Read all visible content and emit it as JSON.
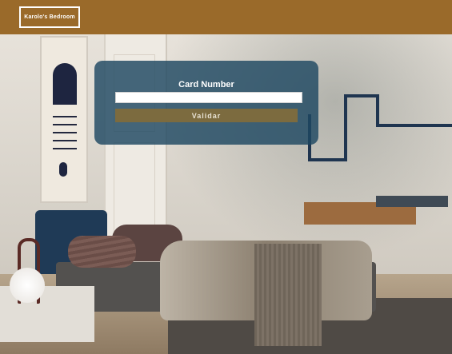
{
  "header": {
    "logo_text": "Karolo's Bedroom"
  },
  "form": {
    "title": "Card Number",
    "input_value": "",
    "submit_label": "Validar"
  },
  "colors": {
    "header_bg": "#9a6a2a",
    "overlay_bg": "#1f4862",
    "button_bg": "#7c6b3f"
  }
}
